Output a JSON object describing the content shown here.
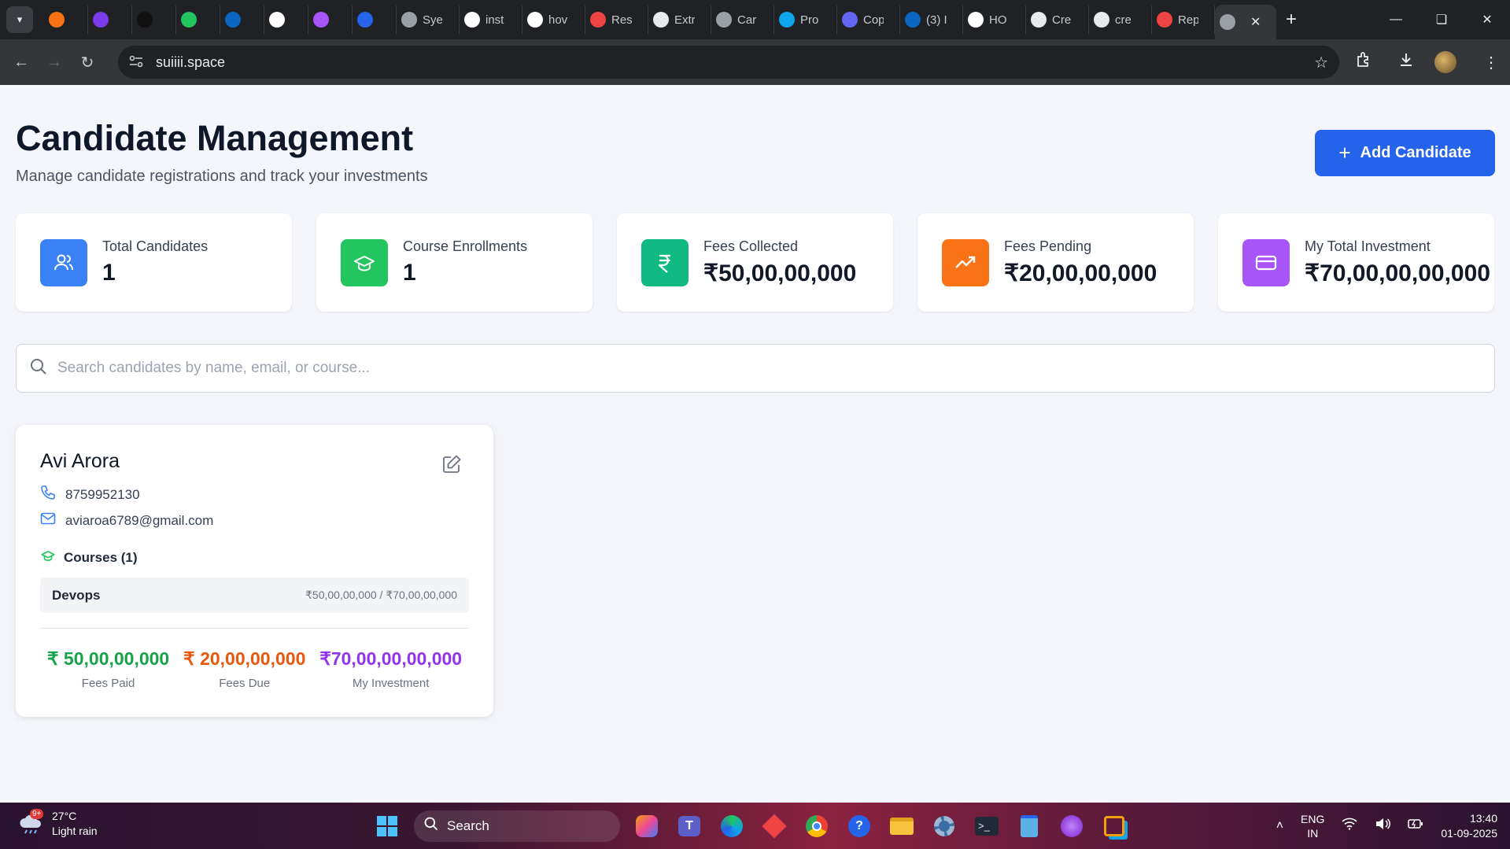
{
  "browser": {
    "tabs": [
      {
        "icon": "firefox-like-icon",
        "title": "",
        "color": "#f97316"
      },
      {
        "icon": "h-logo-icon",
        "title": "",
        "color": "#7c3aed"
      },
      {
        "icon": "tuf-icon",
        "title": "",
        "color": "#111111"
      },
      {
        "icon": "whatsapp-icon",
        "title": "",
        "color": "#22c55e"
      },
      {
        "icon": "linkedin-icon",
        "title": "",
        "color": "#0a66c2"
      },
      {
        "icon": "info-icon",
        "title": "",
        "color": "#ffffff"
      },
      {
        "icon": "stylus-icon",
        "title": "",
        "color": "#a855f7"
      },
      {
        "icon": "k-icon",
        "title": "",
        "color": "#2563eb"
      },
      {
        "icon": "globe-icon",
        "title": "Sye",
        "color": "#9aa0a6"
      },
      {
        "icon": "google-icon",
        "title": "inst",
        "color": "#ffffff"
      },
      {
        "icon": "google-icon",
        "title": "hov",
        "color": "#ffffff"
      },
      {
        "icon": "resume-icon",
        "title": "Res",
        "color": "#ef4444"
      },
      {
        "icon": "openai-icon",
        "title": "Extr",
        "color": "#e8eaed"
      },
      {
        "icon": "globe-icon",
        "title": "Car",
        "color": "#9aa0a6"
      },
      {
        "icon": "c-icon",
        "title": "Pro",
        "color": "#0ea5e9"
      },
      {
        "icon": "copilot-icon",
        "title": "Cop",
        "color": "#6366f1"
      },
      {
        "icon": "linkedin-icon",
        "title": "(3) I",
        "color": "#0a66c2"
      },
      {
        "icon": "github-icon",
        "title": "HO",
        "color": "#ffffff"
      },
      {
        "icon": "cre-icon",
        "title": "Cre",
        "color": "#e8eaed"
      },
      {
        "icon": "grid-icon",
        "title": "cre",
        "color": "#e8eaed"
      },
      {
        "icon": "p-icon",
        "title": "Rep",
        "color": "#ef4444"
      }
    ],
    "active_tab_icon": "globe-icon",
    "url": "suiiii.space"
  },
  "header": {
    "title": "Candidate Management",
    "subtitle": "Manage candidate registrations and track your investments",
    "add_button_label": "Add Candidate"
  },
  "stats": [
    {
      "label": "Total Candidates",
      "value": "1",
      "icon": "users-icon",
      "color": "#3b82f6"
    },
    {
      "label": "Course Enrollments",
      "value": "1",
      "icon": "graduation-cap-icon",
      "color": "#22c55e"
    },
    {
      "label": "Fees Collected",
      "value": "₹50,00,00,000",
      "icon": "rupee-icon",
      "color": "#10b981"
    },
    {
      "label": "Fees Pending",
      "value": "₹20,00,00,000",
      "icon": "trending-up-icon",
      "color": "#f97316"
    },
    {
      "label": "My Total Investment",
      "value": "₹70,00,00,00,000",
      "icon": "credit-card-icon",
      "color": "#a855f7"
    }
  ],
  "search": {
    "placeholder": "Search candidates by name, email, or course...",
    "value": ""
  },
  "candidate": {
    "name": "Avi Arora",
    "phone": "8759952130",
    "email": "aviaroa6789@gmail.com",
    "courses_heading": "Courses (1)",
    "courses": [
      {
        "name": "Devops",
        "fees": "₹50,00,00,000 / ₹70,00,00,000"
      }
    ],
    "totals": [
      {
        "amount": "₹ 50,00,00,000",
        "caption": "Fees Paid",
        "color": "#16a34a"
      },
      {
        "amount": "₹ 20,00,00,000",
        "caption": "Fees Due",
        "color": "#ea580c"
      },
      {
        "amount": "₹70,00,00,00,000",
        "caption": "My Investment",
        "color": "#9333ea"
      }
    ]
  },
  "taskbar": {
    "weather_temp": "27°C",
    "weather_desc": "Light rain",
    "weather_badge": "9+",
    "search_label": "Search",
    "lang_line1": "ENG",
    "lang_line2": "IN",
    "time": "13:40",
    "date": "01-09-2025"
  }
}
